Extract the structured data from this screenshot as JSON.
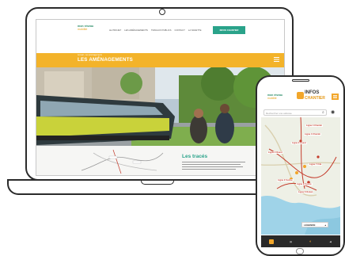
{
  "laptop": {
    "site": {
      "logo_main": "mon réseau",
      "logo_sub": "mobilité",
      "nav": [
        "LE PROJET",
        "LES AMÉNAGEMENTS",
        "TRAVAUX PUBLICS",
        "CONTACT",
        "LA NAVETTE"
      ],
      "nav_cta": "INFOS CHANTIER",
      "breadcrumb": "Accueil › Les aménagements",
      "page_title": "LES AMÉNAGEMENTS",
      "section_title": "Les tracés"
    }
  },
  "phone": {
    "logo_main": "mon réseau",
    "logo_sub": "mobilité",
    "infos_line1": "INFOS",
    "infos_line2": "CHANTIER",
    "search_placeholder": "Rechercher une adresse",
    "map_labels": [
      "Ligne 4 Chemin",
      "Ligne 4 Chemin",
      "Ligne 2 Ouest",
      "Ligne 2 Ouest",
      "Ligne 7 Cité",
      "Ligne 2 Centre",
      "Ligne 9 Centre",
      "Ligne 6 Océan"
    ],
    "legend_label": "LÉGENDE",
    "tabs": [
      "",
      "",
      "",
      ""
    ]
  },
  "colors": {
    "brand_green": "#2aa38a",
    "brand_orange": "#f3b32a",
    "line_red": "#c43b2b"
  }
}
